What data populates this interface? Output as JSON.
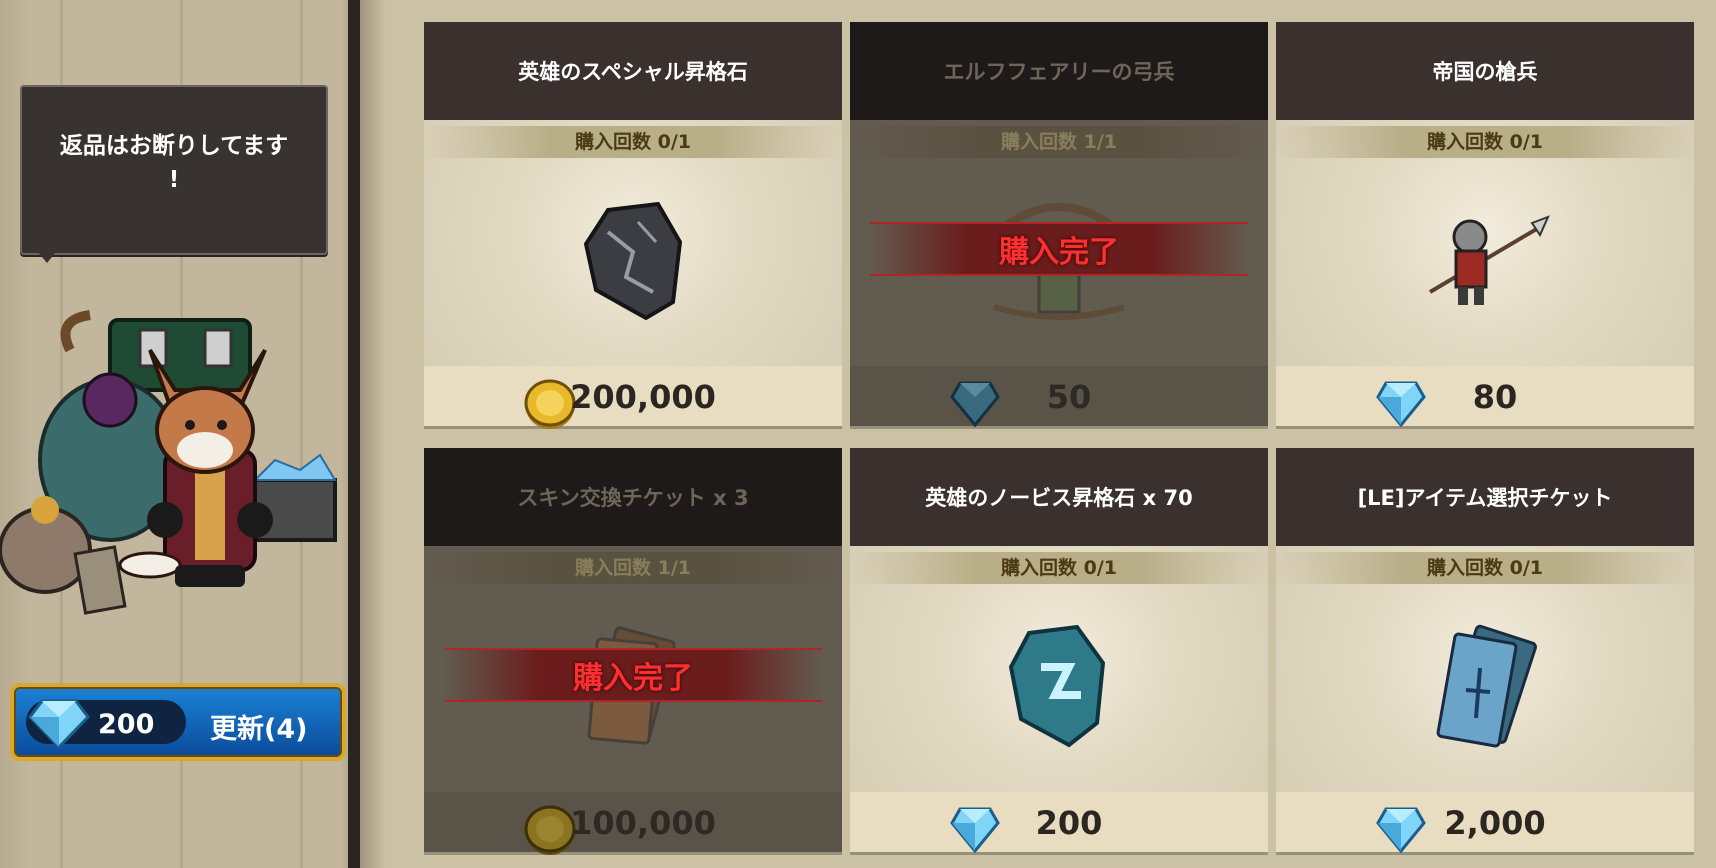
{
  "merchant": {
    "speech": "返品はお断りしてます\n!",
    "refresh": {
      "cost": "200",
      "label": "更新(4)"
    }
  },
  "shop": {
    "items": [
      {
        "title": "英雄のスペシャル昇格石",
        "count": "購入回数 0/1",
        "price": "200,000",
        "currency": "gold-coin-icon",
        "sold": false
      },
      {
        "title": "エルフフェアリーの弓兵",
        "count": "購入回数 1/1",
        "price": "50",
        "currency": "diamond-icon",
        "sold": true,
        "sold_text": "購入完了"
      },
      {
        "title": "帝国の槍兵",
        "count": "購入回数 0/1",
        "price": "80",
        "currency": "diamond-icon",
        "sold": false
      },
      {
        "title": "スキン交換チケット x 3",
        "count": "購入回数 1/1",
        "price": "100,000",
        "currency": "gold-coin-icon",
        "sold": true,
        "sold_text": "購入完了"
      },
      {
        "title": "英雄のノービス昇格石 x 70",
        "count": "購入回数 0/1",
        "price": "200",
        "currency": "diamond-icon",
        "sold": false
      },
      {
        "title": "[LE]アイテム選択チケット",
        "count": "購入回数 0/1",
        "price": "2,000",
        "currency": "diamond-icon",
        "sold": false
      }
    ]
  },
  "colors": {
    "accent_gold": "#d9a92c",
    "button_blue": "#1b82d6",
    "sold_red": "#ff2f2f"
  }
}
